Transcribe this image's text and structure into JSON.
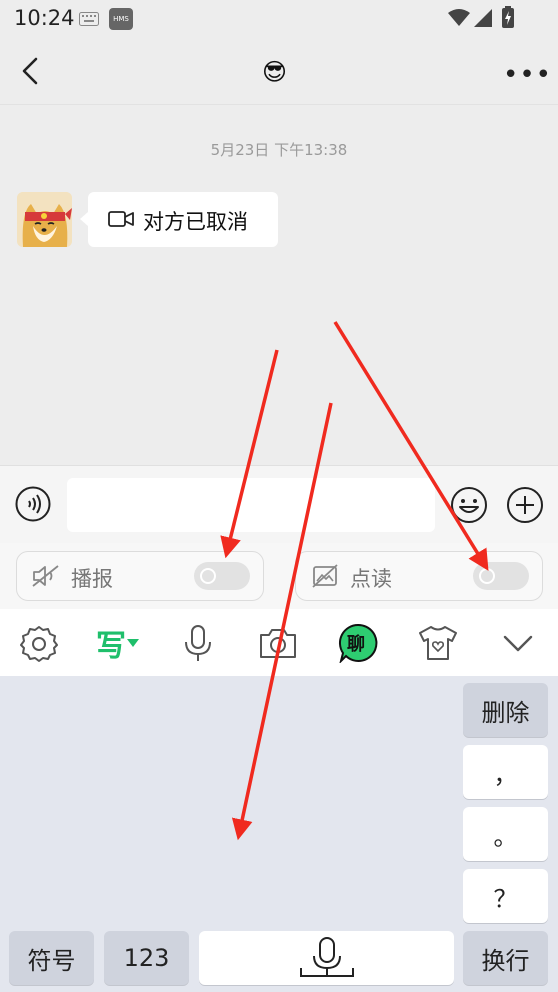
{
  "status_bar": {
    "time": "10:24",
    "badge": "HMS"
  },
  "nav": {
    "title_emoji": "😎",
    "more": "•••"
  },
  "chat": {
    "date": "5月23日 下午13:38",
    "message": "对方已取消"
  },
  "toggles": {
    "broadcast_label": "播报",
    "read_label": "点读"
  },
  "keyboard": {
    "toolbar": {
      "write_label": "写",
      "chat_label": "聊"
    },
    "keys": {
      "delete": "删除",
      "comma": "，",
      "period": "。",
      "question": "？",
      "symbols": "符号",
      "numbers": "123",
      "enter": "换行"
    }
  },
  "colors": {
    "accent_green": "#1fbf6b",
    "arrow_red": "#f02a1f"
  }
}
